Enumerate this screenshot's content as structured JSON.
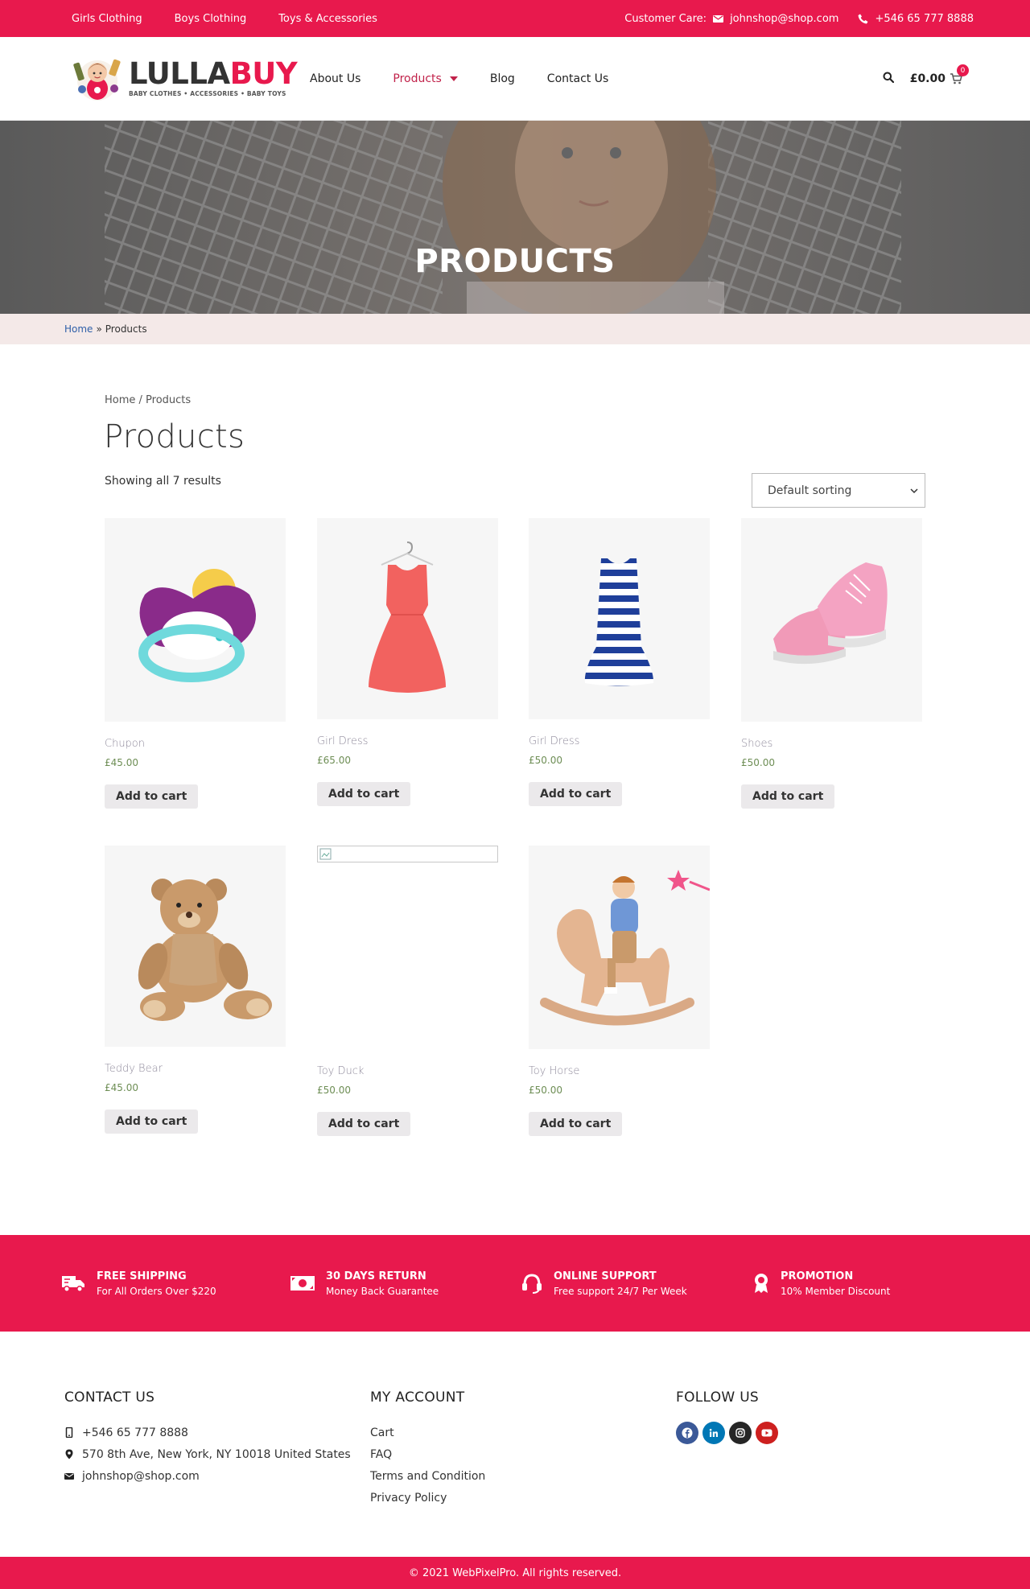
{
  "topbar": {
    "links": [
      "Girls Clothing",
      "Boys Clothing",
      "Toys & Accessories"
    ],
    "customer_care_label": "Customer Care:",
    "email": "johnshop@shop.com",
    "phone": "+546 65 777 8888"
  },
  "header": {
    "logo_name_a": "LULLA",
    "logo_name_b": "BUY",
    "logo_tagline": "BABY CLOTHES • ACCESSORIES • BABY TOYS",
    "nav": {
      "about": "About Us",
      "products": "Products",
      "blog": "Blog",
      "contact": "Contact Us"
    },
    "cart_total": "£0.00",
    "cart_count": "0"
  },
  "hero": {
    "title": "PRODUCTS"
  },
  "breadcrumb": {
    "home": "Home",
    "separator": "»",
    "current": "Products"
  },
  "shop": {
    "breadcrumb": "Home / Products",
    "title": "Products",
    "result_count": "Showing all 7 results",
    "sorting": "Default sorting",
    "add_to_cart_label": "Add to cart",
    "products": [
      {
        "name": "Chupon",
        "price": "£45.00"
      },
      {
        "name": "Girl Dress",
        "price": "£65.00"
      },
      {
        "name": "Girl Dress",
        "price": "£50.00"
      },
      {
        "name": "Shoes",
        "price": "£50.00"
      },
      {
        "name": "Teddy Bear",
        "price": "£45.00"
      },
      {
        "name": "Toy Duck",
        "price": "£50.00"
      },
      {
        "name": "Toy Horse",
        "price": "£50.00"
      }
    ]
  },
  "features": [
    {
      "title": "FREE SHIPPING",
      "subtitle": "For All Orders Over $220",
      "icon": "truck-icon"
    },
    {
      "title": "30 DAYS RETURN",
      "subtitle": "Money Back Guarantee",
      "icon": "money-icon"
    },
    {
      "title": "ONLINE SUPPORT",
      "subtitle": "Free support 24/7 Per Week",
      "icon": "headset-icon"
    },
    {
      "title": "PROMOTION",
      "subtitle": "10% Member Discount",
      "icon": "award-icon"
    }
  ],
  "footer": {
    "contact": {
      "heading": "CONTACT US",
      "phone": "+546 65 777 8888",
      "address": "570 8th Ave, New York, NY 10018 United States",
      "email": "johnshop@shop.com"
    },
    "account": {
      "heading": "MY ACCOUNT",
      "links": [
        "Cart",
        "FAQ",
        "Terms and Condition",
        "Privacy Policy"
      ]
    },
    "follow": {
      "heading": "FOLLOW US",
      "networks": [
        "facebook-icon",
        "linkedin-icon",
        "instagram-icon",
        "youtube-icon"
      ]
    },
    "copyright": "© 2021 WebPixelPro. All rights reserved."
  },
  "colors": {
    "brand": "#e8194d",
    "nav_active": "#c1224a",
    "price": "#6e8e55",
    "product_name": "#8f8a9b",
    "breadcrumb_bg": "#f4e9e8"
  }
}
